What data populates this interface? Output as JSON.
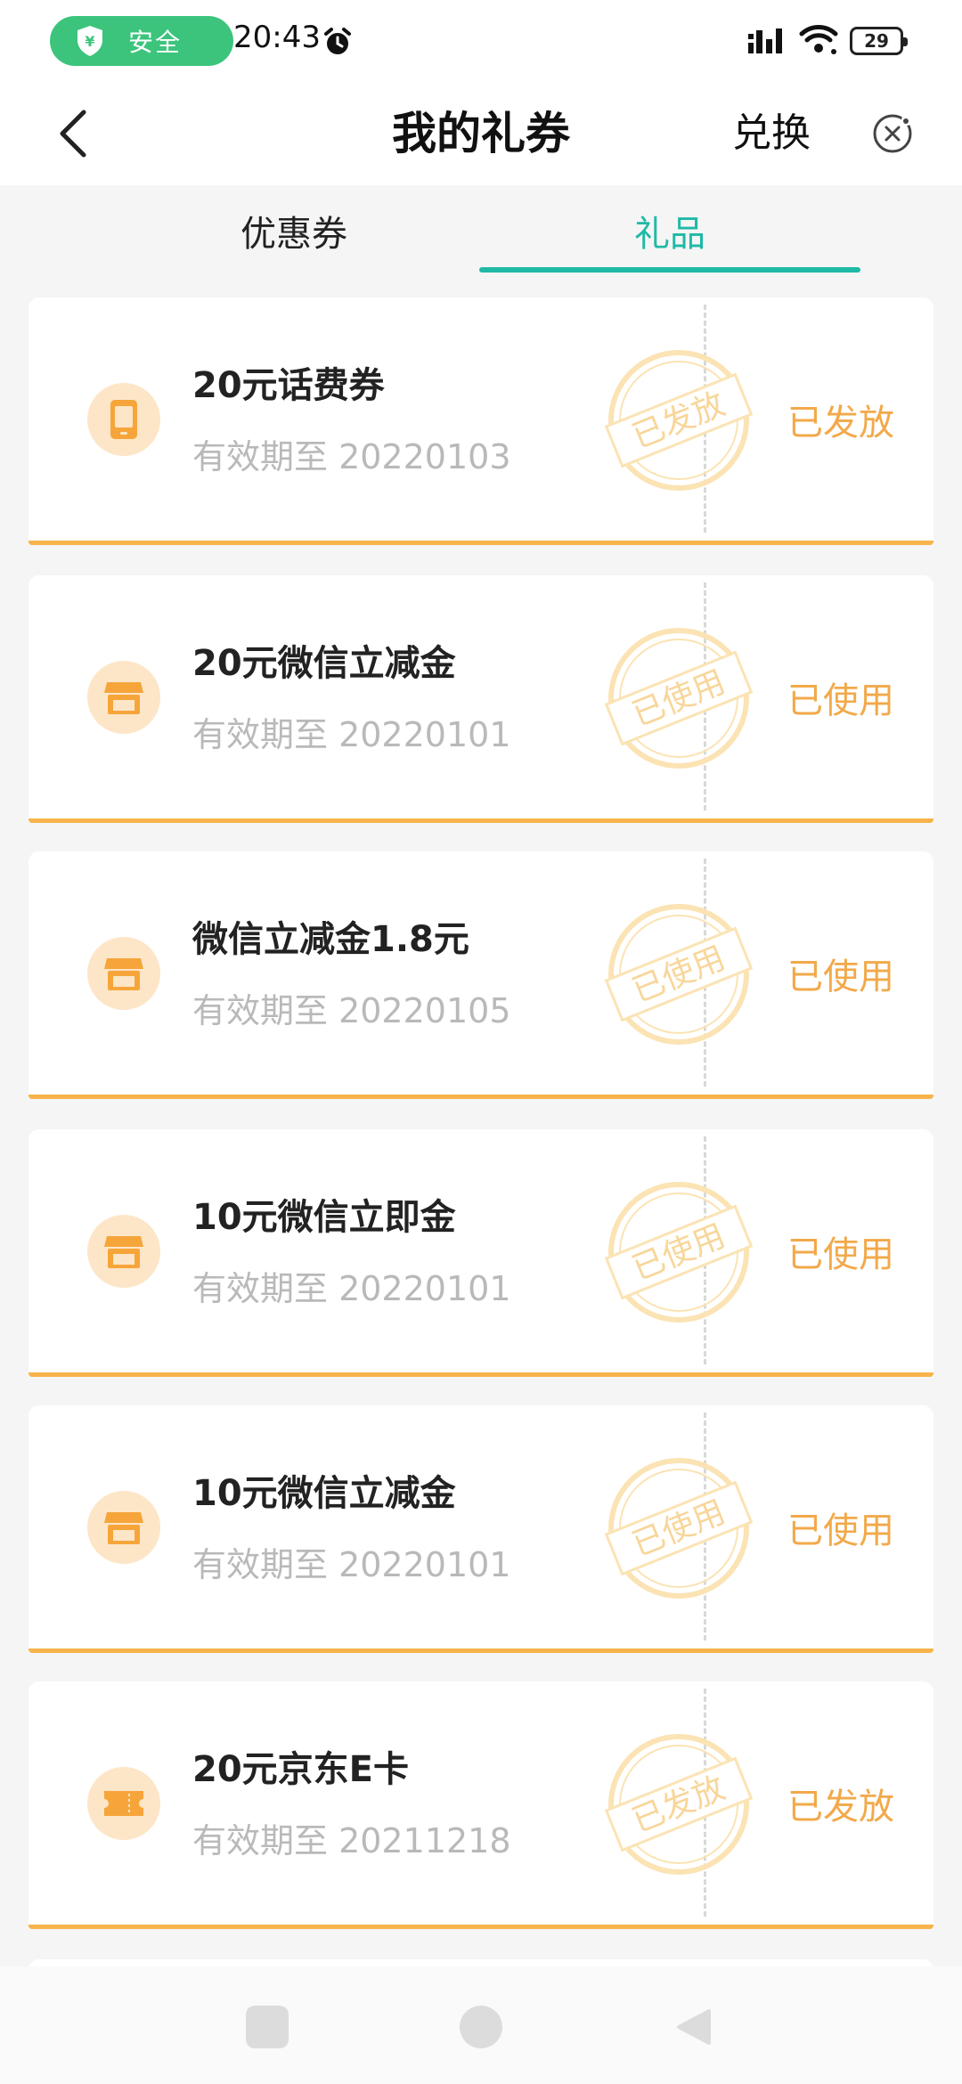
{
  "status_bar": {
    "safe_label": "安全",
    "time": "20:43",
    "battery": "29"
  },
  "header": {
    "title": "我的礼券",
    "exchange_label": "兑换"
  },
  "tabs": [
    {
      "label": "优惠券",
      "active": false
    },
    {
      "label": "礼品",
      "active": true
    }
  ],
  "colors": {
    "accent": "#1fb9a6",
    "status_orange": "#f2a94a",
    "card_bottom": "#f7b44a",
    "icon_bg": "#fde6c8",
    "icon_fg": "#f6a53a"
  },
  "cards": [
    {
      "name": "20元话费券",
      "expiry": "有效期至 20220103",
      "stamp": "已发放",
      "status": "已发放",
      "icon": "phone-icon"
    },
    {
      "name": "20元微信立减金",
      "expiry": "有效期至 20220101",
      "stamp": "已使用",
      "status": "已使用",
      "icon": "shop-icon"
    },
    {
      "name": "微信立减金1.8元",
      "expiry": "有效期至 20220105",
      "stamp": "已使用",
      "status": "已使用",
      "icon": "shop-icon"
    },
    {
      "name": "10元微信立即金",
      "expiry": "有效期至 20220101",
      "stamp": "已使用",
      "status": "已使用",
      "icon": "shop-icon"
    },
    {
      "name": "10元微信立减金",
      "expiry": "有效期至 20220101",
      "stamp": "已使用",
      "status": "已使用",
      "icon": "shop-icon"
    },
    {
      "name": "20元京东E卡",
      "expiry": "有效期至 20211218",
      "stamp": "已发放",
      "status": "已发放",
      "icon": "ticket-icon"
    }
  ]
}
